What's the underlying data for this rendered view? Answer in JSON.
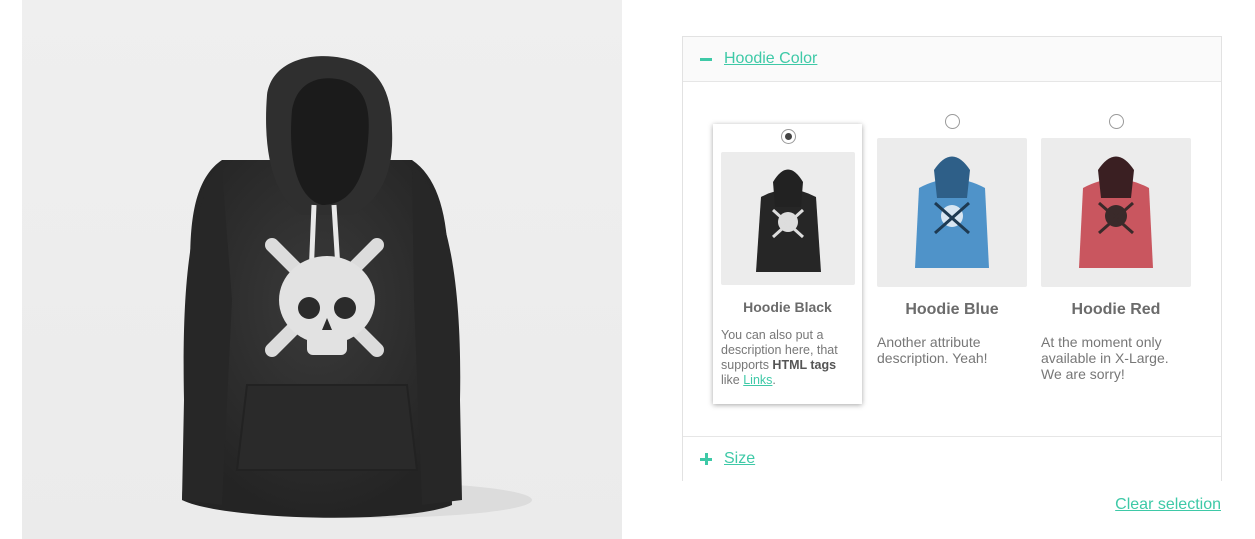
{
  "product": {
    "image_icon": "hoodie-black-skull",
    "main_color": "#2e2e2e"
  },
  "accordion": {
    "color_section": {
      "title": "Hoodie Color",
      "state": "expanded",
      "icon": "minus-icon"
    },
    "size_section": {
      "title": "Size",
      "state": "collapsed",
      "icon": "plus-icon"
    }
  },
  "swatches": [
    {
      "name": "Hoodie Black",
      "selected": true,
      "color": "#2b2b2b",
      "desc_before": "You can also put a description here, that supports ",
      "desc_bold": "HTML tags",
      "desc_mid": " like ",
      "desc_link": "Links",
      "desc_after": "."
    },
    {
      "name": "Hoodie Blue",
      "selected": false,
      "color": "#4f93c9",
      "desc": "Another attribute description. Yeah!"
    },
    {
      "name": "Hoodie Red",
      "selected": false,
      "color": "#c9565f",
      "desc": "At the moment only available in X-Large. We are sorry!"
    }
  ],
  "clear_selection": "Clear selection",
  "accent_color": "#3ec9a7"
}
